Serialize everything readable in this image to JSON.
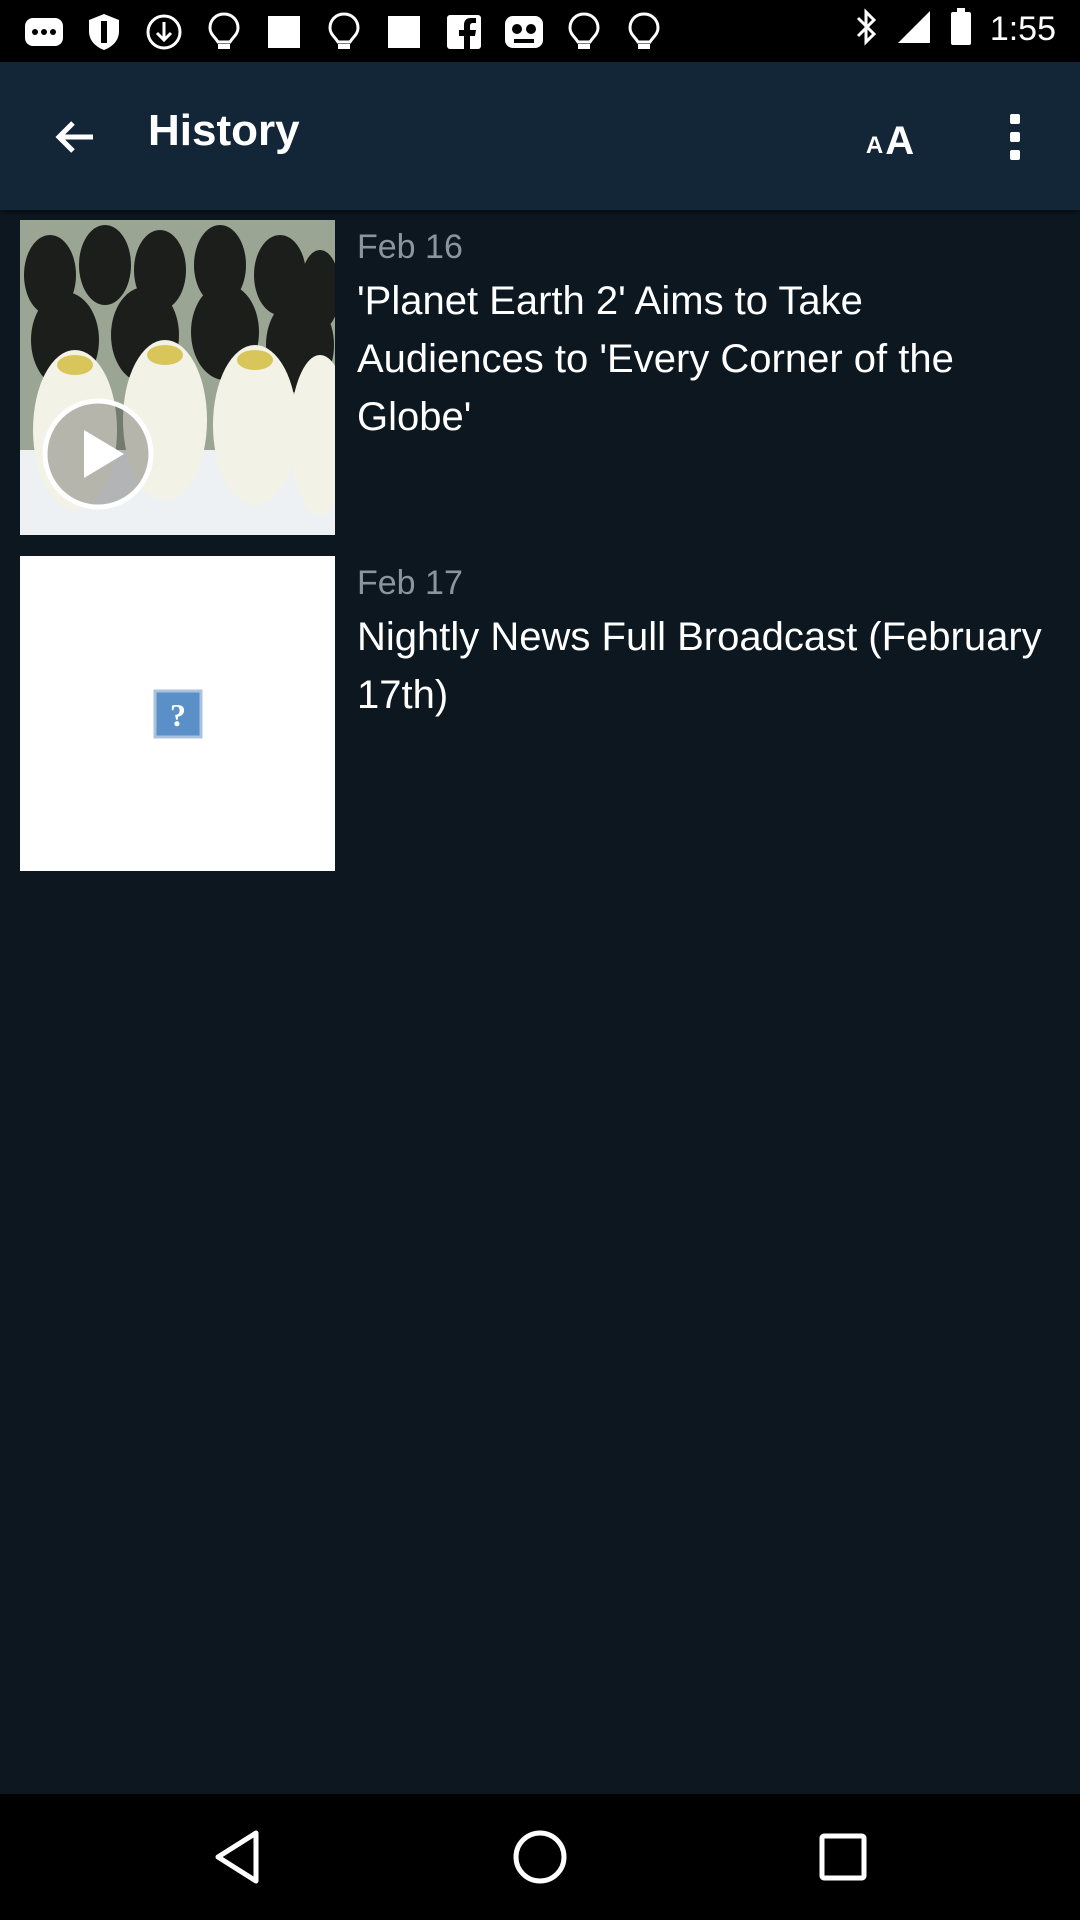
{
  "status_bar": {
    "time": "1:55",
    "left_icons": [
      "more-icon",
      "shield-icon",
      "download-icon",
      "lightbulb-icon",
      "square-icon",
      "lightbulb-icon",
      "square-icon",
      "facebook-icon",
      "mask-icon",
      "lightbulb-icon",
      "lightbulb-icon"
    ],
    "right_icons": [
      "bluetooth-icon",
      "signal-icon",
      "battery-icon"
    ]
  },
  "app_bar": {
    "title": "History",
    "text_size_small": "A",
    "text_size_big": "A"
  },
  "history": {
    "items": [
      {
        "date": "Feb 16",
        "title": "'Planet Earth 2' Aims to Take Audiences to 'Every Corner of the Globe'",
        "thumbnail": "penguins-video"
      },
      {
        "date": "Feb 17",
        "title": "Nightly News Full Broadcast (February 17th)",
        "thumbnail": "missing-image"
      }
    ]
  },
  "nav_bar": {
    "buttons": [
      "back-icon",
      "home-icon",
      "recents-icon"
    ]
  },
  "colors": {
    "app_bar": "#132637",
    "background": "#0c1720",
    "date_text": "#8a959e"
  }
}
